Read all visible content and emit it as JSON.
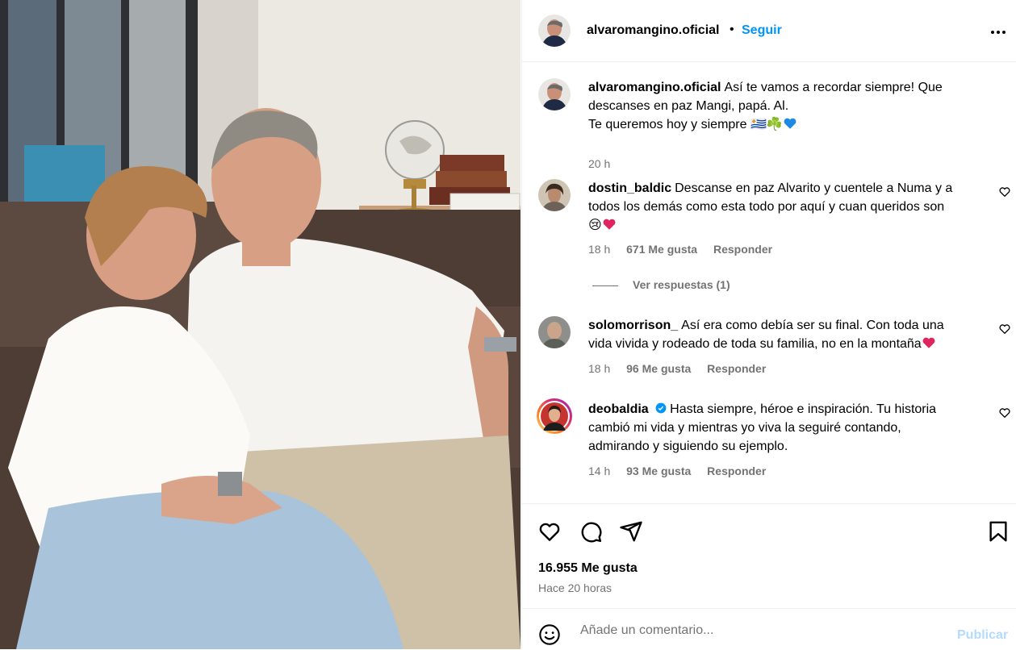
{
  "post": {
    "username": "alvaromangino.oficial",
    "separator": "•",
    "follow_label": "Seguir",
    "more_label": "•••",
    "caption_line1": "Así te vamos a recordar siempre! Que",
    "caption_line2": "descanses en paz Mangi, papá. Al.",
    "caption_line3": "Te queremos hoy y siempre 🇺🇾☘️",
    "caption_time": "20 h"
  },
  "comments": [
    {
      "username": "dostin_baldic",
      "line1": "Descanse en paz Alvarito y cuentele a Numa y a",
      "line2": "todos los demás como esta todo por aquí y cuan queridos son",
      "line3": "😢",
      "time": "18 h",
      "likes": "671 Me gusta",
      "reply_label": "Responder",
      "view_replies": "Ver respuestas (1)"
    },
    {
      "username": "solomorrison_",
      "line1": "Así era como debía ser su final. Con toda una",
      "line2": "vida vivida y rodeado de toda su familia, no en la montaña",
      "time": "18 h",
      "likes": "96 Me gusta",
      "reply_label": "Responder"
    },
    {
      "username": "deobaldia",
      "line1": "Hasta siempre, héroe e inspiración. Tu historia",
      "line2": "cambió mi vida y mientras yo viva la seguiré contando,",
      "line3": "admirando y siguiendo su ejemplo.",
      "time": "14 h",
      "likes": "93 Me gusta",
      "reply_label": "Responder"
    }
  ],
  "footer": {
    "likes_count": "16.955 Me gusta",
    "time_ago": "Hace 20 horas",
    "comment_placeholder": "Añade un comentario...",
    "publish_label": "Publicar"
  },
  "colors": {
    "link_blue": "#0095f6",
    "publish_disabled": "#b3dbff",
    "muted": "#737373",
    "heart_red": "#e0245e",
    "heart_blue": "#1e88e5"
  },
  "icons": [
    "heart-icon",
    "comment-icon",
    "share-icon",
    "bookmark-icon",
    "emoji-icon",
    "more-icon",
    "verified-icon"
  ]
}
